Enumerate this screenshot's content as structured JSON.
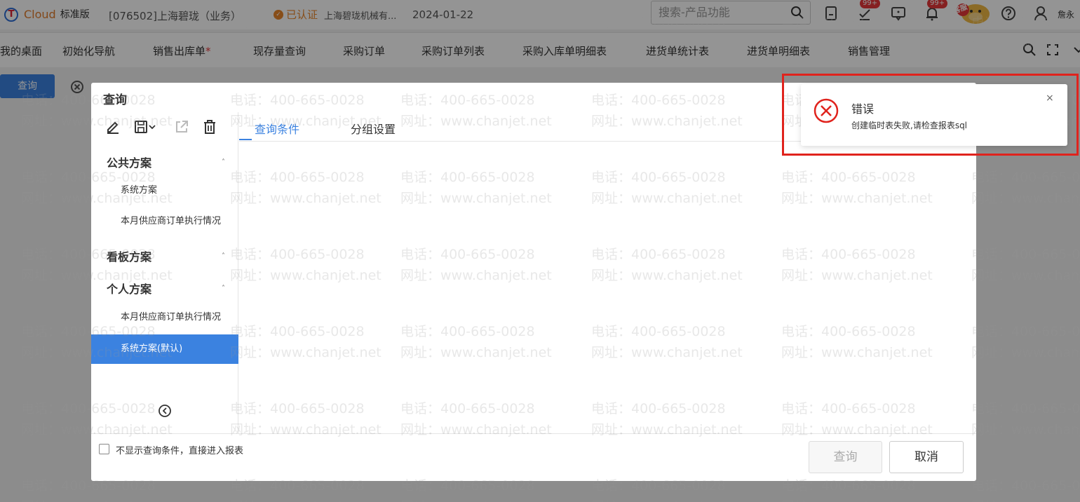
{
  "header": {
    "brand_name": "Cloud",
    "edition": "标准版",
    "account": "[076502]上海碧珑（业务）",
    "certified_label": "已认证",
    "company": "上海碧珑机械有...",
    "date": "2024-01-22",
    "search_placeholder": "搜索-产品功能",
    "tasks_badge": "99+",
    "notifications_badge": "99+",
    "service_label": "客服",
    "user_name": "詹永"
  },
  "nav": {
    "tabs": [
      {
        "label": "我的桌面"
      },
      {
        "label": "初始化导航"
      },
      {
        "label": "销售出库单",
        "required_mark": "*"
      },
      {
        "label": "现存量查询"
      },
      {
        "label": "采购订单"
      },
      {
        "label": "采购订单列表"
      },
      {
        "label": "采购入库单明细表"
      },
      {
        "label": "进货单统计表"
      },
      {
        "label": "进货单明细表"
      },
      {
        "label": "销售管理"
      }
    ]
  },
  "page": {
    "query_button": "查询"
  },
  "watermark": {
    "phone": "电话：400-665-0028",
    "site": "网址：www.chanjet.net"
  },
  "dialog": {
    "title": "查询",
    "public_group": "公共方案",
    "public_items": [
      "系统方案",
      "本月供应商订单执行情况"
    ],
    "board_group": "看板方案",
    "personal_group": "个人方案",
    "personal_items": [
      "本月供应商订单执行情况",
      "系统方案(默认)"
    ],
    "tabs": [
      "查询条件",
      "分组设置"
    ],
    "skip_checkbox_label": "不显示查询条件，直接进入报表",
    "query_button": "查询",
    "cancel_button": "取消"
  },
  "toast": {
    "title": "错误",
    "message": "创建临时表失败,请检查报表sql",
    "close": "×"
  },
  "colors": {
    "primary": "#3b82e0",
    "error": "#e0231d",
    "cert": "#e8862a"
  }
}
